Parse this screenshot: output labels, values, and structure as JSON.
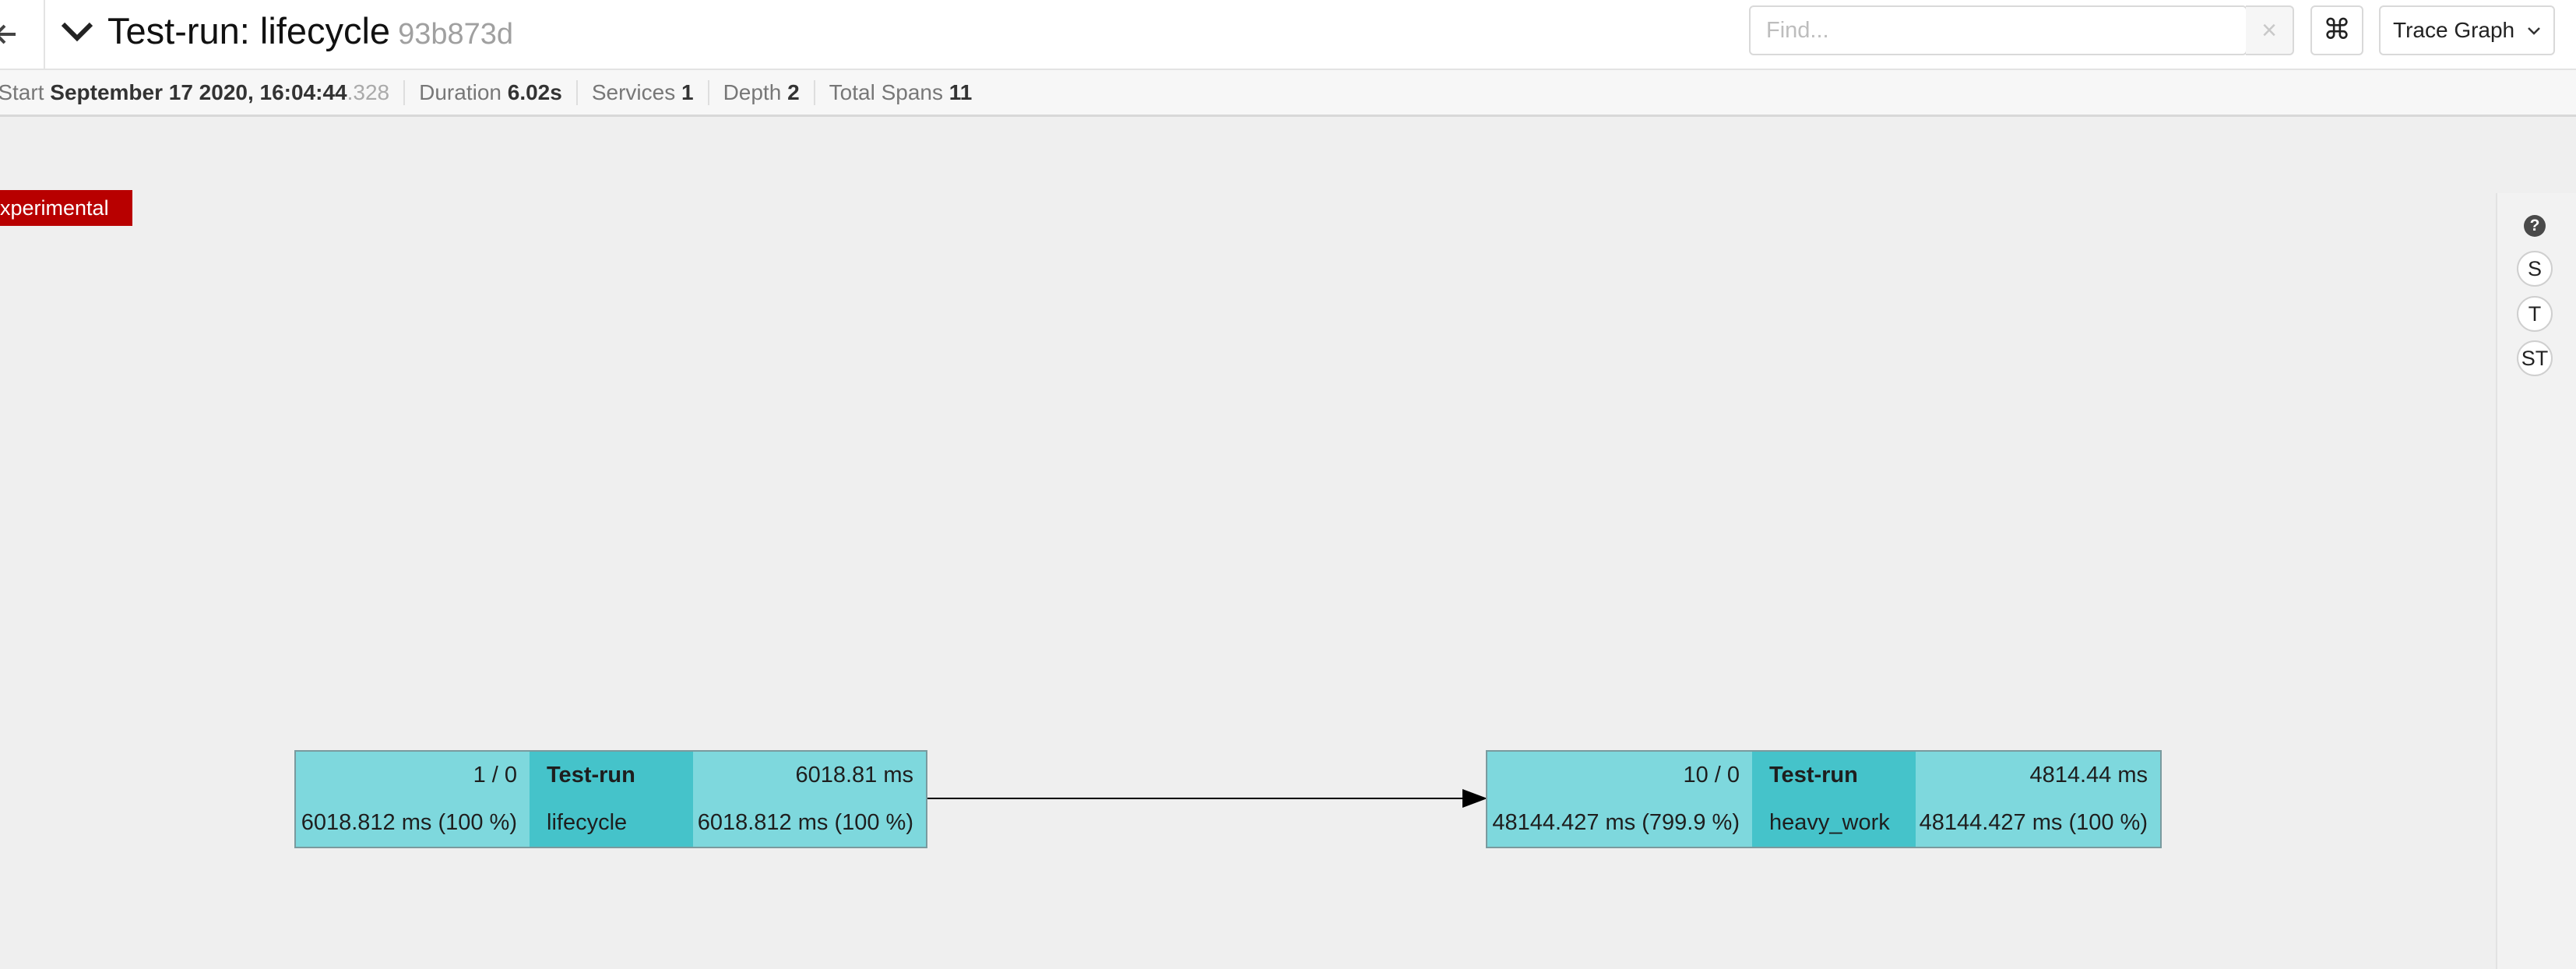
{
  "header": {
    "title": "Test-run: lifecycle",
    "trace_id": "93b873d",
    "search": {
      "placeholder": "Find...",
      "value": ""
    },
    "clear_glyph": "×",
    "shortcut_glyph": "⌘",
    "view_selected": "Trace Graph"
  },
  "meta": {
    "trace_start_label": "ce Start",
    "trace_start_value": "September 17 2020, 16:04:44",
    "trace_start_ms": ".328",
    "duration_label": "Duration",
    "duration_value": "6.02s",
    "services_label": "Services",
    "services_value": "1",
    "depth_label": "Depth",
    "depth_value": "2",
    "total_spans_label": "Total Spans",
    "total_spans_value": "11"
  },
  "badge": "xperimental",
  "side_panel": {
    "help": "?",
    "buttons": [
      "S",
      "T",
      "ST"
    ]
  },
  "nodes": [
    {
      "count": "1 / 0",
      "total_time": "6018.812 ms (100 %)",
      "service": "Test-run",
      "operation": "lifecycle",
      "self_time": "6018.81 ms",
      "self_pct": "6018.812 ms (100 %)"
    },
    {
      "count": "10 / 0",
      "total_time": "48144.427 ms (799.9 %)",
      "service": "Test-run",
      "operation": "heavy_work",
      "self_time": "4814.44 ms",
      "self_pct": "48144.427 ms (100 %)"
    }
  ],
  "colors": {
    "node_outer": "#7ed8dd",
    "node_center": "#45c3ca",
    "experimental_badge": "#b80000"
  }
}
